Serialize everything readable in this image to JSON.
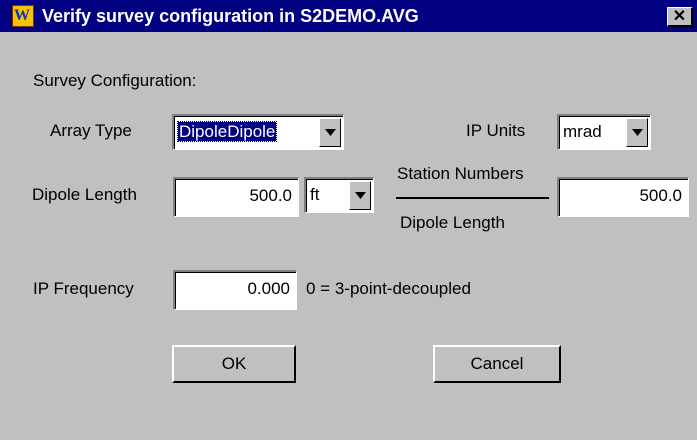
{
  "window": {
    "title": "Verify survey configuration in S2DEMO.AVG",
    "close_glyph": "✕"
  },
  "section_label": "Survey Configuration:",
  "array_type": {
    "label": "Array Type",
    "value": "DipoleDipole"
  },
  "ip_units": {
    "label": "IP Units",
    "value": "mrad"
  },
  "dipole_length": {
    "label": "Dipole Length",
    "value": "500.0",
    "unit": "ft"
  },
  "station_ratio": {
    "numerator": "Station Numbers",
    "denominator": "Dipole Length",
    "value": "500.0"
  },
  "ip_frequency": {
    "label": "IP Frequency",
    "value": "0.000",
    "hint": "0 = 3-point-decoupled"
  },
  "buttons": {
    "ok": "OK",
    "cancel": "Cancel"
  },
  "icons": {
    "app": "app-logo-icon",
    "close": "close-icon",
    "dropdown": "chevron-down-icon"
  },
  "colors": {
    "titlebar": "#000080",
    "face": "#c0c0c0",
    "selection": "#000080"
  }
}
